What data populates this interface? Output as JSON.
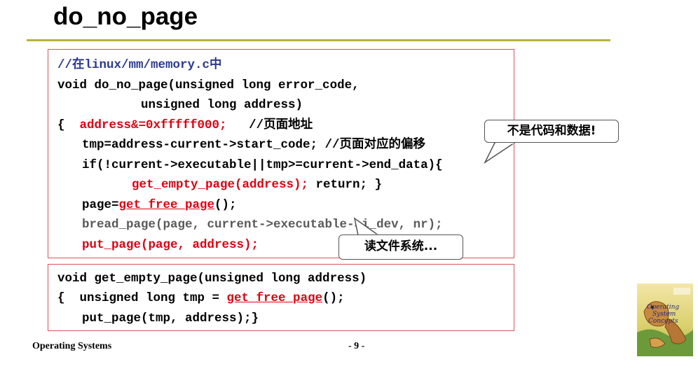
{
  "slide": {
    "title": "do_no_page",
    "colors": {
      "title_rule": "#b5b43a",
      "box_border": "#e0505a",
      "comment": "#2b3a8f",
      "highlight": "#e00010",
      "gray_code": "#5a5a5a"
    }
  },
  "code1": {
    "line1": "//在linux/mm/memory.c中",
    "line2": "void do_no_page(unsigned long error_code,",
    "line3": "unsigned long address)",
    "line4_brace": "{",
    "line4_stmt": "address&=0xfffff000;",
    "line4_comment": "//页面地址",
    "line5": "tmp=address-current->start_code; //页面对应的偏移",
    "line6": "if(!current->executable||tmp>=current->end_data){",
    "line7_call": "get_empty_page(address);",
    "line7_rest": " return; }",
    "line8_prefix": "page=",
    "line8_call": "get_free_page",
    "line8_suffix": "();",
    "line9": "bread_page(page, current->executable->i_dev, nr);",
    "line10": "put_page(page, address);"
  },
  "code2": {
    "line1": "void get_empty_page(unsigned long address)",
    "line2_prefix": "{  unsigned long tmp = ",
    "line2_call": "get_free_page",
    "line2_suffix": "();",
    "line3": "put_page(tmp, address);}"
  },
  "callouts": {
    "not_code_data": "不是代码和数据!",
    "read_fs": "读文件系统..."
  },
  "footer": {
    "course": "Operating Systems",
    "page_number": "- 9 -"
  },
  "logo": {
    "icon": "operating-system-concepts-book-cover-icon",
    "text_line1": "Operating",
    "text_line2": "System",
    "text_line3": "Concepts"
  }
}
